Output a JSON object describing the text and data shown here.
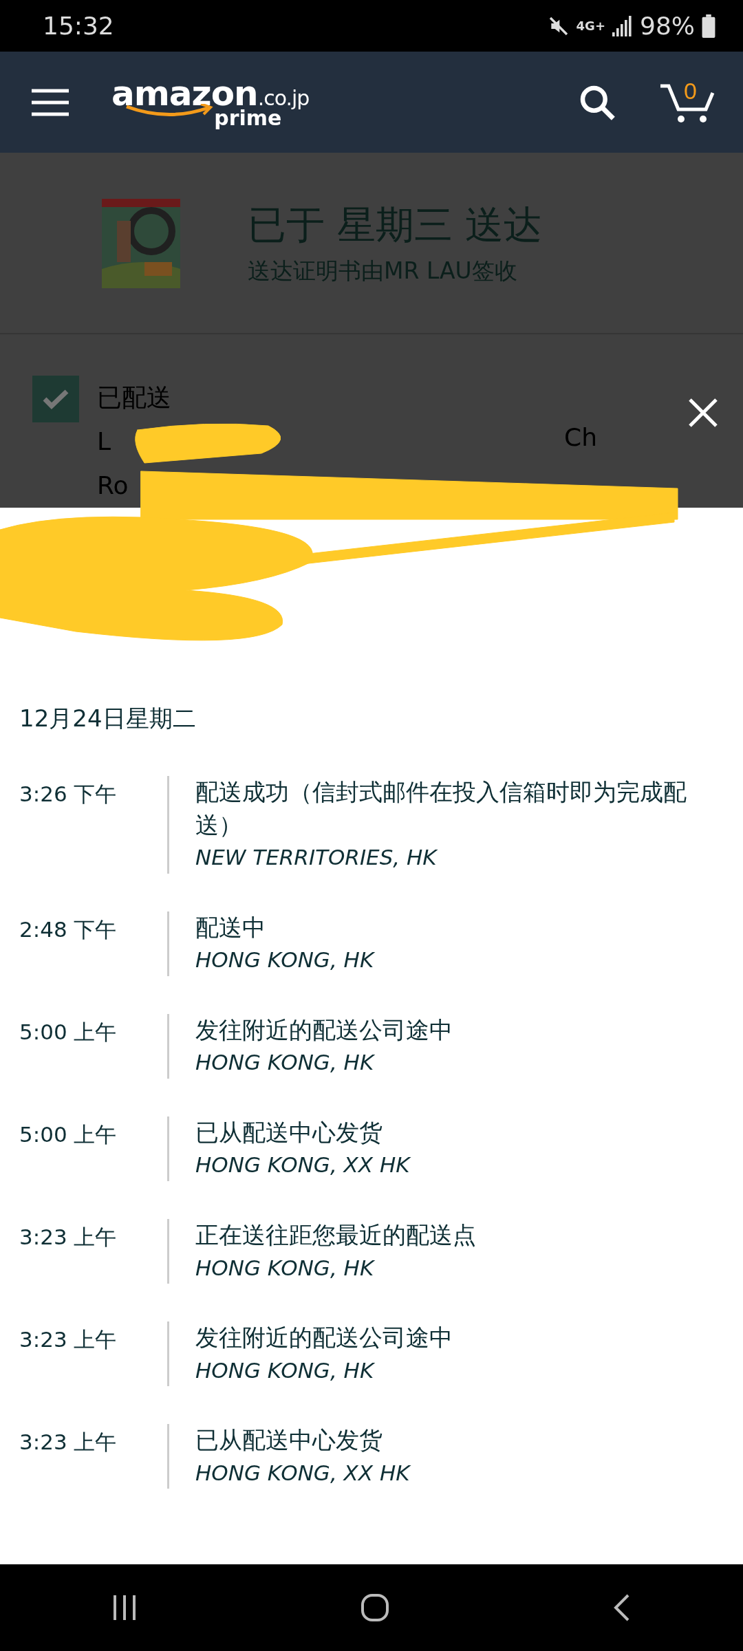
{
  "status_bar": {
    "time": "15:32",
    "network": "4G+",
    "battery": "98%"
  },
  "header": {
    "logo": {
      "brand": "amazon",
      "domain": ".co.jp",
      "tier": "prime"
    },
    "cart_count": "0"
  },
  "delivery": {
    "title": "已于 星期三 送达",
    "subtitle": "送达证明书由MR LAU签收"
  },
  "status": {
    "checked": true,
    "label": "已配送",
    "address_lines": [
      "L",
      "Ro"
    ],
    "address_tail": "Ch"
  },
  "tracking": {
    "date": "12月24日星期二",
    "events": [
      {
        "time": "3:26 下午",
        "description": "配送成功（信封式邮件在投入信箱时即为完成配送）",
        "location": "NEW TERRITORIES, HK"
      },
      {
        "time": "2:48 下午",
        "description": "配送中",
        "location": "HONG KONG, HK"
      },
      {
        "time": "5:00 上午",
        "description": "发往附近的配送公司途中",
        "location": "HONG KONG, HK"
      },
      {
        "time": "5:00 上午",
        "description": "已从配送中心发货",
        "location": "HONG KONG, XX HK"
      },
      {
        "time": "3:23 上午",
        "description": "正在送往距您最近的配送点",
        "location": "HONG KONG, HK"
      },
      {
        "time": "3:23 上午",
        "description": "发往附近的配送公司途中",
        "location": "HONG KONG, HK"
      },
      {
        "time": "3:23 上午",
        "description": "已从配送中心发货",
        "location": "HONG KONG, XX HK"
      }
    ]
  }
}
